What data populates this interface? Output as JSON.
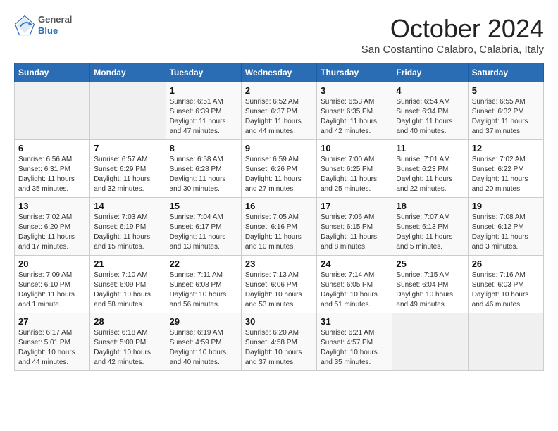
{
  "header": {
    "logo_general": "General",
    "logo_blue": "Blue",
    "month_title": "October 2024",
    "subtitle": "San Costantino Calabro, Calabria, Italy"
  },
  "weekdays": [
    "Sunday",
    "Monday",
    "Tuesday",
    "Wednesday",
    "Thursday",
    "Friday",
    "Saturday"
  ],
  "weeks": [
    [
      {
        "day": "",
        "info": ""
      },
      {
        "day": "",
        "info": ""
      },
      {
        "day": "1",
        "info": "Sunrise: 6:51 AM\nSunset: 6:39 PM\nDaylight: 11 hours and 47 minutes."
      },
      {
        "day": "2",
        "info": "Sunrise: 6:52 AM\nSunset: 6:37 PM\nDaylight: 11 hours and 44 minutes."
      },
      {
        "day": "3",
        "info": "Sunrise: 6:53 AM\nSunset: 6:35 PM\nDaylight: 11 hours and 42 minutes."
      },
      {
        "day": "4",
        "info": "Sunrise: 6:54 AM\nSunset: 6:34 PM\nDaylight: 11 hours and 40 minutes."
      },
      {
        "day": "5",
        "info": "Sunrise: 6:55 AM\nSunset: 6:32 PM\nDaylight: 11 hours and 37 minutes."
      }
    ],
    [
      {
        "day": "6",
        "info": "Sunrise: 6:56 AM\nSunset: 6:31 PM\nDaylight: 11 hours and 35 minutes."
      },
      {
        "day": "7",
        "info": "Sunrise: 6:57 AM\nSunset: 6:29 PM\nDaylight: 11 hours and 32 minutes."
      },
      {
        "day": "8",
        "info": "Sunrise: 6:58 AM\nSunset: 6:28 PM\nDaylight: 11 hours and 30 minutes."
      },
      {
        "day": "9",
        "info": "Sunrise: 6:59 AM\nSunset: 6:26 PM\nDaylight: 11 hours and 27 minutes."
      },
      {
        "day": "10",
        "info": "Sunrise: 7:00 AM\nSunset: 6:25 PM\nDaylight: 11 hours and 25 minutes."
      },
      {
        "day": "11",
        "info": "Sunrise: 7:01 AM\nSunset: 6:23 PM\nDaylight: 11 hours and 22 minutes."
      },
      {
        "day": "12",
        "info": "Sunrise: 7:02 AM\nSunset: 6:22 PM\nDaylight: 11 hours and 20 minutes."
      }
    ],
    [
      {
        "day": "13",
        "info": "Sunrise: 7:02 AM\nSunset: 6:20 PM\nDaylight: 11 hours and 17 minutes."
      },
      {
        "day": "14",
        "info": "Sunrise: 7:03 AM\nSunset: 6:19 PM\nDaylight: 11 hours and 15 minutes."
      },
      {
        "day": "15",
        "info": "Sunrise: 7:04 AM\nSunset: 6:17 PM\nDaylight: 11 hours and 13 minutes."
      },
      {
        "day": "16",
        "info": "Sunrise: 7:05 AM\nSunset: 6:16 PM\nDaylight: 11 hours and 10 minutes."
      },
      {
        "day": "17",
        "info": "Sunrise: 7:06 AM\nSunset: 6:15 PM\nDaylight: 11 hours and 8 minutes."
      },
      {
        "day": "18",
        "info": "Sunrise: 7:07 AM\nSunset: 6:13 PM\nDaylight: 11 hours and 5 minutes."
      },
      {
        "day": "19",
        "info": "Sunrise: 7:08 AM\nSunset: 6:12 PM\nDaylight: 11 hours and 3 minutes."
      }
    ],
    [
      {
        "day": "20",
        "info": "Sunrise: 7:09 AM\nSunset: 6:10 PM\nDaylight: 11 hours and 1 minute."
      },
      {
        "day": "21",
        "info": "Sunrise: 7:10 AM\nSunset: 6:09 PM\nDaylight: 10 hours and 58 minutes."
      },
      {
        "day": "22",
        "info": "Sunrise: 7:11 AM\nSunset: 6:08 PM\nDaylight: 10 hours and 56 minutes."
      },
      {
        "day": "23",
        "info": "Sunrise: 7:13 AM\nSunset: 6:06 PM\nDaylight: 10 hours and 53 minutes."
      },
      {
        "day": "24",
        "info": "Sunrise: 7:14 AM\nSunset: 6:05 PM\nDaylight: 10 hours and 51 minutes."
      },
      {
        "day": "25",
        "info": "Sunrise: 7:15 AM\nSunset: 6:04 PM\nDaylight: 10 hours and 49 minutes."
      },
      {
        "day": "26",
        "info": "Sunrise: 7:16 AM\nSunset: 6:03 PM\nDaylight: 10 hours and 46 minutes."
      }
    ],
    [
      {
        "day": "27",
        "info": "Sunrise: 6:17 AM\nSunset: 5:01 PM\nDaylight: 10 hours and 44 minutes."
      },
      {
        "day": "28",
        "info": "Sunrise: 6:18 AM\nSunset: 5:00 PM\nDaylight: 10 hours and 42 minutes."
      },
      {
        "day": "29",
        "info": "Sunrise: 6:19 AM\nSunset: 4:59 PM\nDaylight: 10 hours and 40 minutes."
      },
      {
        "day": "30",
        "info": "Sunrise: 6:20 AM\nSunset: 4:58 PM\nDaylight: 10 hours and 37 minutes."
      },
      {
        "day": "31",
        "info": "Sunrise: 6:21 AM\nSunset: 4:57 PM\nDaylight: 10 hours and 35 minutes."
      },
      {
        "day": "",
        "info": ""
      },
      {
        "day": "",
        "info": ""
      }
    ]
  ]
}
